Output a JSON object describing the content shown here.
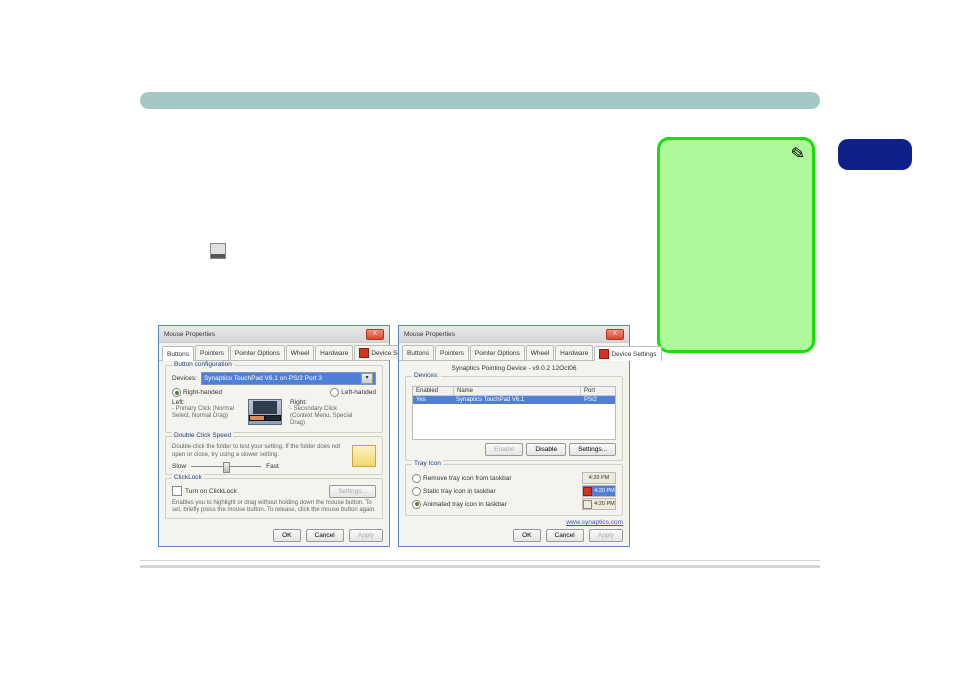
{
  "note": {
    "icon_glyph": "✎"
  },
  "dialog": {
    "title": "Mouse Properties",
    "tabs": [
      "Buttons",
      "Pointers",
      "Pointer Options",
      "Wheel",
      "Hardware",
      "Device Settings"
    ]
  },
  "buttons_tab": {
    "group_btncfg": "Button configuration",
    "devices_label": "Devices:",
    "device_selected": "Synaptics TouchPad V6.1 on PS/2 Port 3",
    "right_handed": "Right-handed",
    "left_handed": "Left-handed",
    "left_col_title": "Left:",
    "left_col_sub": "- Primary Click (Normal Select, Normal Drag)",
    "right_col_title": "Right:",
    "right_col_sub": "- Secondary Click (Context Menu, Special Drag)",
    "group_dbl": "Double Click Speed",
    "dbl_text": "Double-click the folder to test your setting. If the folder does not open or close, try using a slower setting.",
    "slow": "Slow",
    "fast": "Fast",
    "group_cl": "ClickLock",
    "cl_turn_on": "Turn on ClickLock",
    "cl_settings": "Settings...",
    "cl_desc": "Enables you to highlight or drag without holding down the mouse button. To set, briefly press the mouse button. To release, click the mouse button again."
  },
  "device_tab": {
    "version": "Synaptics Pointing Device - v9.0.2 12Oct06",
    "group_devices": "Devices:",
    "col_enabled": "Enabled",
    "col_name": "Name",
    "col_port": "Port",
    "row_enabled": "Yes",
    "row_name": "Synaptics TouchPad V6.1",
    "row_port": "PS/2",
    "btn_enable": "Enable",
    "btn_disable": "Disable",
    "btn_settings": "Settings...",
    "group_tray": "Tray Icon",
    "opt_remove": "Remove tray icon from taskbar",
    "opt_static": "Static tray icon in taskbar",
    "opt_anim": "Animated tray icon in taskbar",
    "clock": "4:20 PM",
    "link": "www.synaptics.com"
  },
  "footer": {
    "ok": "OK",
    "cancel": "Cancel",
    "apply": "Apply"
  }
}
